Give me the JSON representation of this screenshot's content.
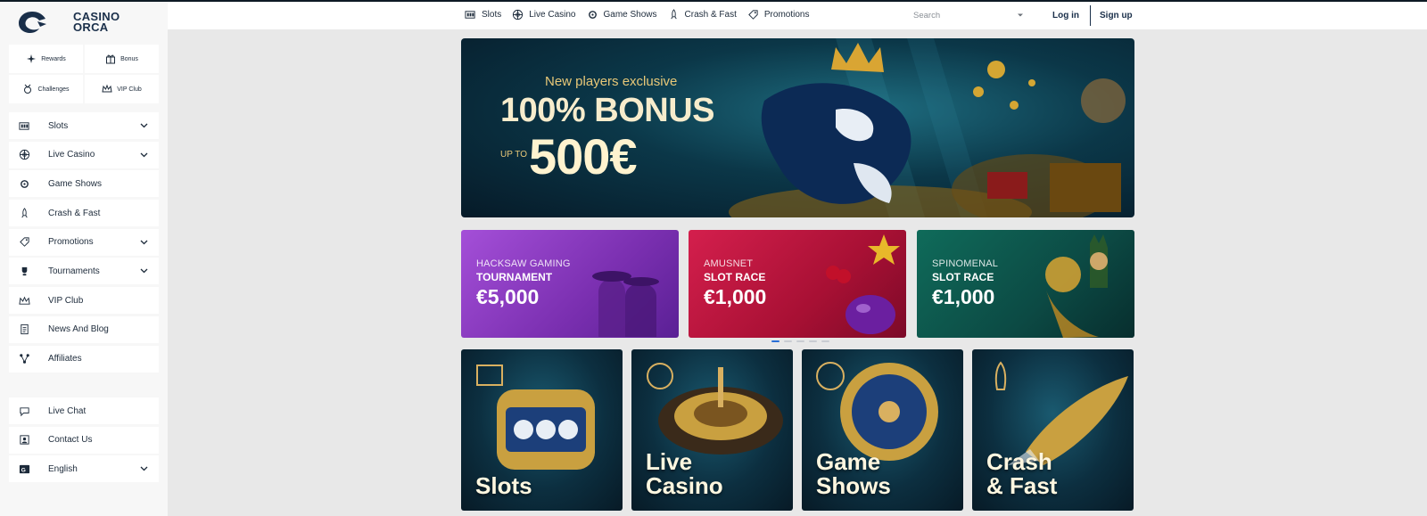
{
  "brand": {
    "name_line1": "CASINO",
    "name_line2": "ORCA"
  },
  "quick_links": [
    {
      "label": "Rewards",
      "icon": "sparkle-icon"
    },
    {
      "label": "Bonus",
      "icon": "gift-icon"
    },
    {
      "label": "Challenges",
      "icon": "medal-icon"
    },
    {
      "label": "VIP Club",
      "icon": "crown-icon"
    }
  ],
  "sidebar": {
    "items": [
      {
        "label": "Slots",
        "icon": "slot-machine-icon",
        "has_chevron": true
      },
      {
        "label": "Live Casino",
        "icon": "roulette-icon",
        "has_chevron": true
      },
      {
        "label": "Game Shows",
        "icon": "wheel-icon",
        "has_chevron": false
      },
      {
        "label": "Crash & Fast",
        "icon": "rocket-icon",
        "has_chevron": false
      },
      {
        "label": "Promotions",
        "icon": "tag-icon",
        "has_chevron": true
      },
      {
        "label": "Tournaments",
        "icon": "trophy-icon",
        "has_chevron": true
      },
      {
        "label": "VIP Club",
        "icon": "crown-icon",
        "has_chevron": false
      },
      {
        "label": "News And Blog",
        "icon": "document-icon",
        "has_chevron": false
      },
      {
        "label": "Affiliates",
        "icon": "network-icon",
        "has_chevron": false
      }
    ],
    "bottom_items": [
      {
        "label": "Live Chat",
        "icon": "chat-icon",
        "has_chevron": false
      },
      {
        "label": "Contact Us",
        "icon": "contact-icon",
        "has_chevron": false
      },
      {
        "label": "English",
        "icon": "language-icon",
        "has_chevron": true
      }
    ]
  },
  "topnav": [
    {
      "label": "Slots",
      "icon": "slot-machine-icon"
    },
    {
      "label": "Live Casino",
      "icon": "roulette-icon"
    },
    {
      "label": "Game Shows",
      "icon": "wheel-icon"
    },
    {
      "label": "Crash & Fast",
      "icon": "rocket-icon"
    },
    {
      "label": "Promotions",
      "icon": "tag-icon"
    }
  ],
  "search": {
    "placeholder": "Search"
  },
  "auth": {
    "login": "Log in",
    "signup": "Sign up"
  },
  "hero": {
    "tag": "New players exclusive",
    "headline": "100% BONUS",
    "upto": "UP TO",
    "amount": "500€"
  },
  "promos": [
    {
      "provider": "HACKSAW GAMING",
      "type": "TOURNAMENT",
      "amount": "€5,000"
    },
    {
      "provider": "AMUSNET",
      "type": "SLOT RACE",
      "amount": "€1,000"
    },
    {
      "provider": "SPINOMENAL",
      "type": "SLOT RACE",
      "amount": "€1,000"
    }
  ],
  "carousel": {
    "total": 5,
    "active": 1
  },
  "categories": [
    {
      "label": "Slots"
    },
    {
      "label": "Live\nCasino"
    },
    {
      "label": "Game\nShows"
    },
    {
      "label": "Crash\n& Fast"
    }
  ]
}
